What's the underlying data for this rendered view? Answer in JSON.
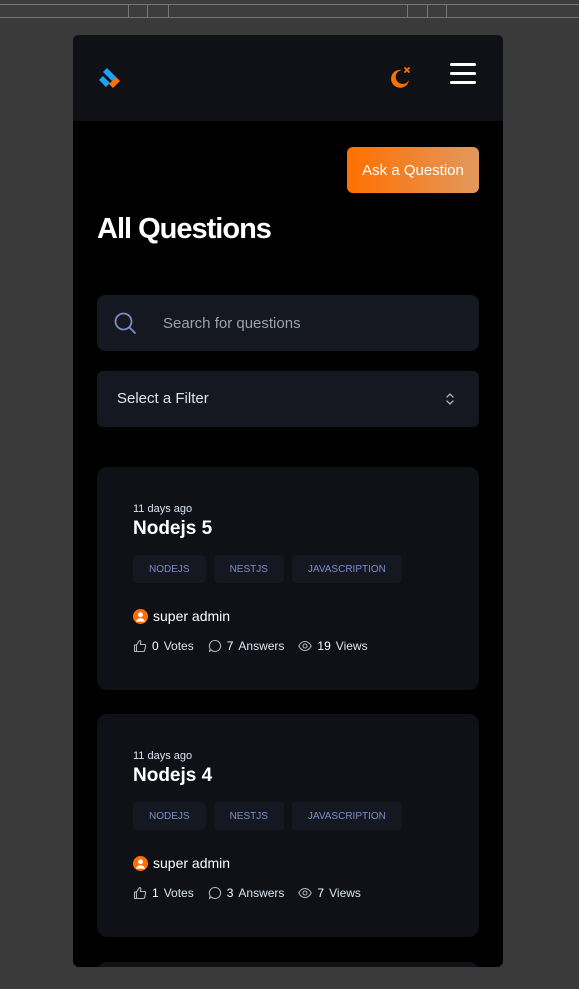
{
  "header": {
    "logo_icon": "devflow-logo-icon",
    "theme_icon": "moon-icon",
    "menu_icon": "hamburger-menu-icon"
  },
  "colors": {
    "accent": "#ff7000",
    "accent_end": "#e2985e",
    "logo_blue": "#1da1f2",
    "tag_text": "#7b8ec8",
    "card_bg": "#0f1117",
    "input_bg": "#151821"
  },
  "main": {
    "ask_button": "Ask a Question",
    "title": "All Questions",
    "search": {
      "placeholder": "Search for questions",
      "value": ""
    },
    "filter": {
      "selected": "Select a Filter"
    }
  },
  "questions": [
    {
      "time": "11 days ago",
      "title": "Nodejs 5",
      "tags": [
        "NODEJS",
        "NESTJS",
        "JAVASCRIPTION"
      ],
      "author": "super admin",
      "votes": "0",
      "votes_label": "Votes",
      "answers": "7",
      "answers_label": "Answers",
      "views": "19",
      "views_label": "Views"
    },
    {
      "time": "11 days ago",
      "title": "Nodejs 4",
      "tags": [
        "NODEJS",
        "NESTJS",
        "JAVASCRIPTION"
      ],
      "author": "super admin",
      "votes": "1",
      "votes_label": "Votes",
      "answers": "3",
      "answers_label": "Answers",
      "views": "7",
      "views_label": "Views"
    }
  ]
}
